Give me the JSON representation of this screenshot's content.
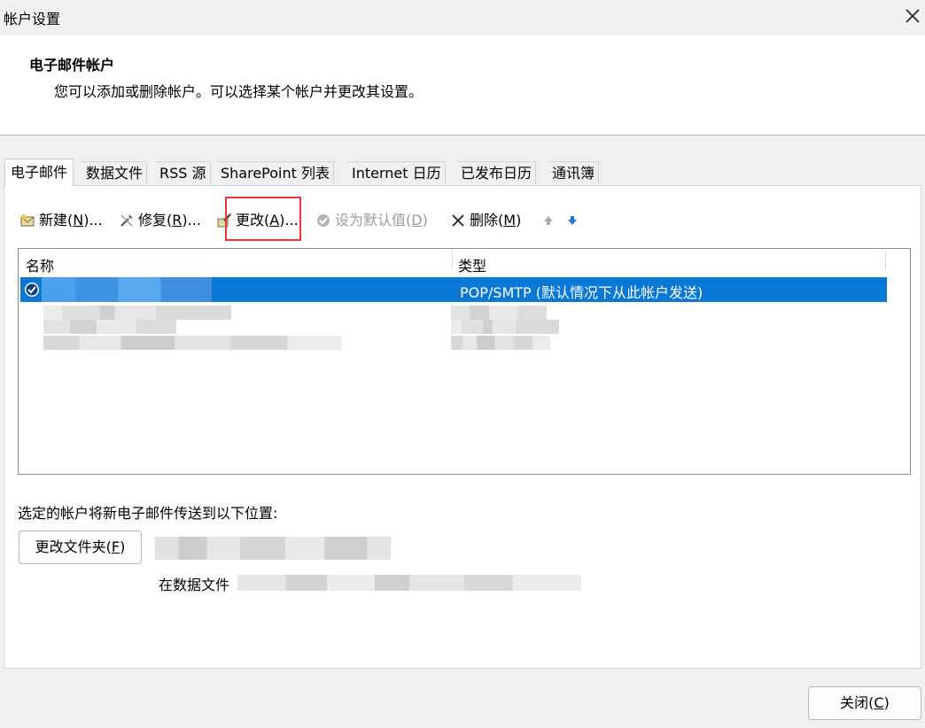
{
  "window": {
    "title": "帐户设置"
  },
  "header": {
    "title": "电子邮件帐户",
    "description": "您可以添加或删除帐户。可以选择某个帐户并更改其设置。"
  },
  "tabs": [
    {
      "label": "电子邮件",
      "active": true
    },
    {
      "label": "数据文件"
    },
    {
      "label": "RSS 源"
    },
    {
      "label": "SharePoint 列表"
    },
    {
      "label": "Internet 日历"
    },
    {
      "label": "已发布日历"
    },
    {
      "label": "通讯簿"
    }
  ],
  "toolbar": {
    "new": {
      "text": "新建(",
      "key": "N",
      "suffix": ")..."
    },
    "repair": {
      "text": "修复(",
      "key": "R",
      "suffix": ")..."
    },
    "change": {
      "text": "更改(",
      "key": "A",
      "suffix": ")..."
    },
    "set_default": {
      "text": "设为默认值(",
      "key": "D",
      "suffix": ")"
    },
    "remove": {
      "text": "删除(",
      "key": "M",
      "suffix": ")"
    }
  },
  "accounts_list": {
    "columns": {
      "name": "名称",
      "type": "类型"
    },
    "rows": [
      {
        "type": "POP/SMTP (默认情况下从此帐户发送)",
        "selected": true
      }
    ]
  },
  "delivery": {
    "label": "选定的帐户将新电子邮件传送到以下位置:",
    "change_folder": {
      "text": "更改文件夹(",
      "key": "F",
      "suffix": ")"
    },
    "data_file_prefix": "在数据文件"
  },
  "footer": {
    "close": {
      "text": "关闭(",
      "key": "C",
      "suffix": ")"
    }
  },
  "colors": {
    "selection": "#0a78d7",
    "highlight_box": "#e03a3a"
  },
  "icons": [
    "close-icon",
    "new-account-icon",
    "repair-icon",
    "change-icon",
    "set-default-icon",
    "remove-icon",
    "move-up-icon",
    "move-down-icon",
    "default-account-check-icon"
  ]
}
